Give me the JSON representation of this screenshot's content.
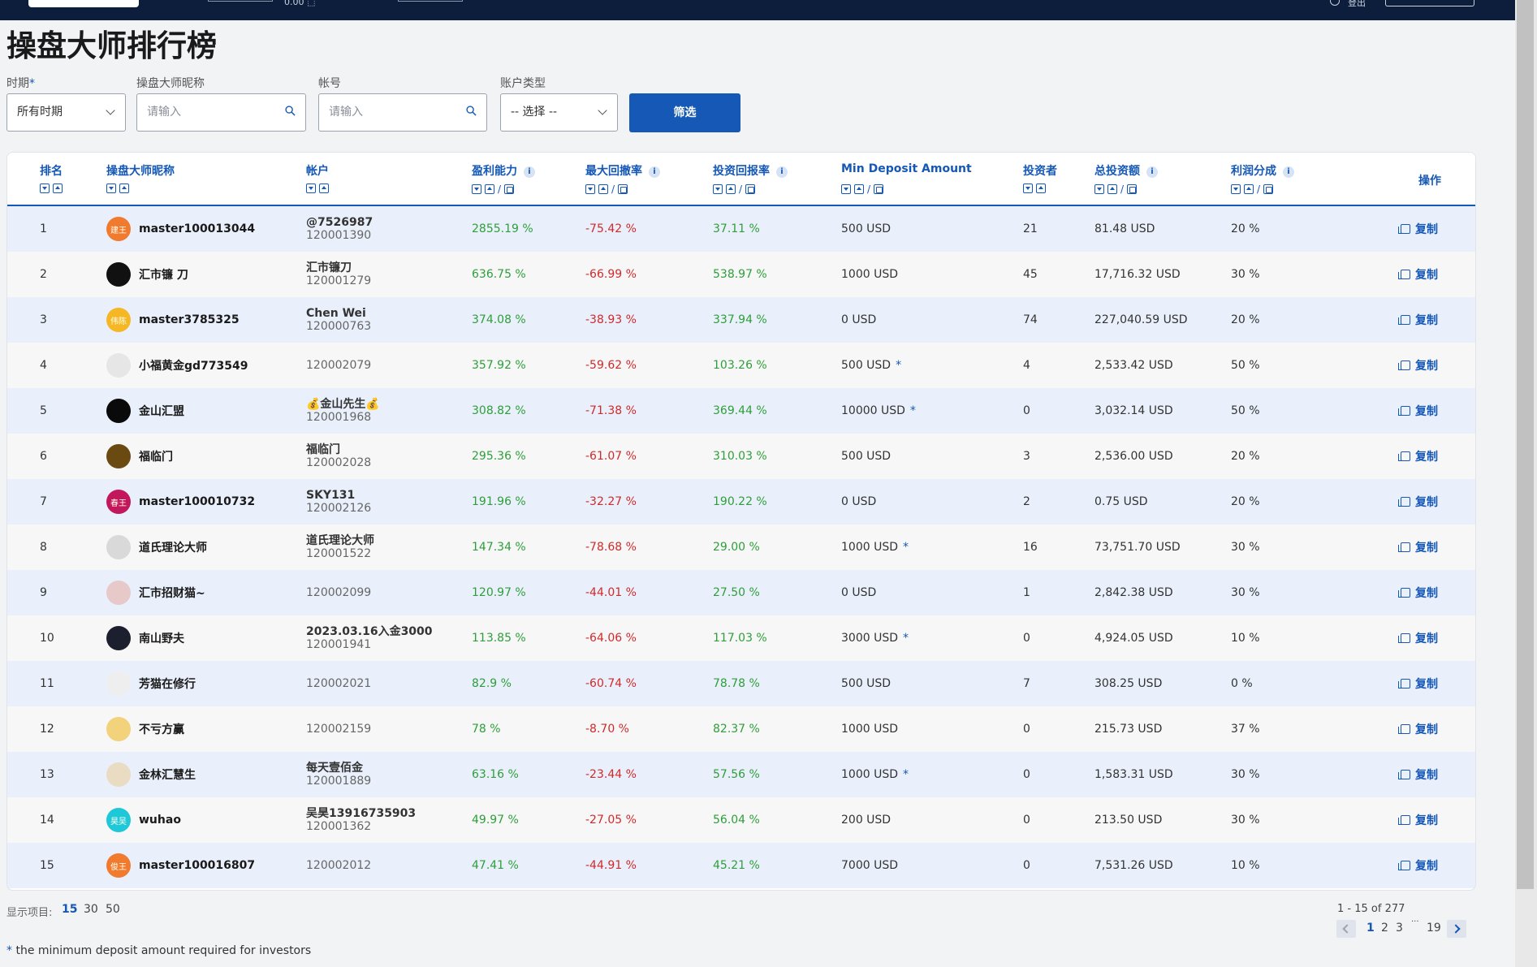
{
  "topbar": {
    "balance": "0.00 ⬚",
    "user_text": "登出"
  },
  "page": {
    "title": "操盘大师排行榜"
  },
  "filters": {
    "period_label": "时期",
    "period_required": "*",
    "period_value": "所有时期",
    "nickname_label": "操盘大师昵称",
    "nickname_placeholder": "请输入",
    "account_label": "帐号",
    "account_placeholder": "请输入",
    "type_label": "账户类型",
    "type_value": "-- 选择 --",
    "filter_button": "筛选"
  },
  "columns": {
    "rank": "排名",
    "nickname": "操盘大师昵称",
    "account": "帐户",
    "profit": "盈利能力",
    "drawdown": "最大回撤率",
    "roi": "投资回报率",
    "min_deposit": "Min Deposit Amount",
    "investors": "投资者",
    "total": "总投资额",
    "share": "利润分成",
    "action": "操作",
    "info": "i",
    "slash": "/"
  },
  "copy_label": "复制",
  "rows": [
    {
      "rank": "1",
      "name": "master100013044",
      "avatar_text": "建王",
      "avatar_color": "#f07a2e",
      "acct_name": "@7526987",
      "acct_num": "120001390",
      "profit": "2855.19 %",
      "dd": "-75.42 %",
      "roi": "37.11 %",
      "dep": "500 USD",
      "dep_star": "",
      "inv": "21",
      "total": "81.48 USD",
      "share": "20 %"
    },
    {
      "rank": "2",
      "name": "汇市镰 刀",
      "avatar_text": "",
      "avatar_color": "#111111",
      "acct_name": "汇市镰刀",
      "acct_num": "120001279",
      "profit": "636.75 %",
      "dd": "-66.99 %",
      "roi": "538.97 %",
      "dep": "1000 USD",
      "dep_star": "",
      "inv": "45",
      "total": "17,716.32 USD",
      "share": "30 %"
    },
    {
      "rank": "3",
      "name": "master3785325",
      "avatar_text": "伟陈",
      "avatar_color": "#f5b724",
      "acct_name": "Chen Wei",
      "acct_num": "120000763",
      "profit": "374.08 %",
      "dd": "-38.93 %",
      "roi": "337.94 %",
      "dep": "0 USD",
      "dep_star": "",
      "inv": "74",
      "total": "227,040.59 USD",
      "share": "20 %"
    },
    {
      "rank": "4",
      "name": "小福黄金gd773549",
      "avatar_text": "",
      "avatar_color": "#e6e6e6",
      "acct_name": "",
      "acct_num": "120002079",
      "profit": "357.92 %",
      "dd": "-59.62 %",
      "roi": "103.26 %",
      "dep": "500 USD",
      "dep_star": "*",
      "inv": "4",
      "total": "2,533.42 USD",
      "share": "50 %"
    },
    {
      "rank": "5",
      "name": "金山汇盟",
      "avatar_text": "",
      "avatar_color": "#0a0a0a",
      "acct_name": "💰金山先生💰",
      "acct_num": "120001968",
      "profit": "308.82 %",
      "dd": "-71.38 %",
      "roi": "369.44 %",
      "dep": "10000 USD",
      "dep_star": "*",
      "inv": "0",
      "total": "3,032.14 USD",
      "share": "50 %"
    },
    {
      "rank": "6",
      "name": "福临门",
      "avatar_text": "",
      "avatar_color": "#6b4a12",
      "acct_name": "福临门",
      "acct_num": "120002028",
      "profit": "295.36 %",
      "dd": "-61.07 %",
      "roi": "310.03 %",
      "dep": "500 USD",
      "dep_star": "",
      "inv": "3",
      "total": "2,536.00 USD",
      "share": "20 %"
    },
    {
      "rank": "7",
      "name": "master100010732",
      "avatar_text": "春王",
      "avatar_color": "#c2185b",
      "acct_name": "SKY131",
      "acct_num": "120002126",
      "profit": "191.96 %",
      "dd": "-32.27 %",
      "roi": "190.22 %",
      "dep": "0 USD",
      "dep_star": "",
      "inv": "2",
      "total": "0.75 USD",
      "share": "20 %"
    },
    {
      "rank": "8",
      "name": "道氏理论大师",
      "avatar_text": "",
      "avatar_color": "#d9d9d9",
      "acct_name": "道氏理论大师",
      "acct_num": "120001522",
      "profit": "147.34 %",
      "dd": "-78.68 %",
      "roi": "29.00 %",
      "dep": "1000 USD",
      "dep_star": "*",
      "inv": "16",
      "total": "73,751.70 USD",
      "share": "30 %"
    },
    {
      "rank": "9",
      "name": "汇市招财猫~",
      "avatar_text": "",
      "avatar_color": "#e8c9c9",
      "acct_name": "",
      "acct_num": "120002099",
      "profit": "120.97 %",
      "dd": "-44.01 %",
      "roi": "27.50 %",
      "dep": "0 USD",
      "dep_star": "",
      "inv": "1",
      "total": "2,842.38 USD",
      "share": "30 %"
    },
    {
      "rank": "10",
      "name": "南山野夫",
      "avatar_text": "",
      "avatar_color": "#1b1f2e",
      "acct_name": "2023.03.16入金3000",
      "acct_num": "120001941",
      "profit": "113.85 %",
      "dd": "-64.06 %",
      "roi": "117.03 %",
      "dep": "3000 USD",
      "dep_star": "*",
      "inv": "0",
      "total": "4,924.05 USD",
      "share": "10 %"
    },
    {
      "rank": "11",
      "name": "芳猫在修行",
      "avatar_text": "",
      "avatar_color": "#eeeeee",
      "acct_name": "",
      "acct_num": "120002021",
      "profit": "82.9 %",
      "dd": "-60.74 %",
      "roi": "78.78 %",
      "dep": "500 USD",
      "dep_star": "",
      "inv": "7",
      "total": "308.25 USD",
      "share": "0 %"
    },
    {
      "rank": "12",
      "name": "不亏方赢",
      "avatar_text": "",
      "avatar_color": "#f2d27a",
      "acct_name": "",
      "acct_num": "120002159",
      "profit": "78 %",
      "dd": "-8.70 %",
      "roi": "82.37 %",
      "dep": "1000 USD",
      "dep_star": "",
      "inv": "0",
      "total": "215.73 USD",
      "share": "37 %"
    },
    {
      "rank": "13",
      "name": "金林汇慧生",
      "avatar_text": "",
      "avatar_color": "#e9dcc2",
      "acct_name": "每天壹佰金",
      "acct_num": "120001889",
      "profit": "63.16 %",
      "dd": "-23.44 %",
      "roi": "57.56 %",
      "dep": "1000 USD",
      "dep_star": "*",
      "inv": "0",
      "total": "1,583.31 USD",
      "share": "30 %"
    },
    {
      "rank": "14",
      "name": "wuhao",
      "avatar_text": "昊吴",
      "avatar_color": "#1ec8d8",
      "acct_name": "吴昊13916735903",
      "acct_num": "120001362",
      "profit": "49.97 %",
      "dd": "-27.05 %",
      "roi": "56.04 %",
      "dep": "200 USD",
      "dep_star": "",
      "inv": "0",
      "total": "213.50 USD",
      "share": "30 %"
    },
    {
      "rank": "15",
      "name": "master100016807",
      "avatar_text": "俊王",
      "avatar_color": "#f07a2e",
      "acct_name": "",
      "acct_num": "120002012",
      "profit": "47.41 %",
      "dd": "-44.91 %",
      "roi": "45.21 %",
      "dep": "7000 USD",
      "dep_star": "",
      "inv": "0",
      "total": "7,531.26 USD",
      "share": "10 %"
    }
  ],
  "footer": {
    "show_label": "显示项目:",
    "sizes": [
      "15",
      "30",
      "50"
    ],
    "range": "1 - 15 of 277",
    "pages": [
      "1",
      "2",
      "3",
      "···",
      "19"
    ],
    "note_star": "*",
    "note": " the minimum deposit amount required for investors"
  }
}
